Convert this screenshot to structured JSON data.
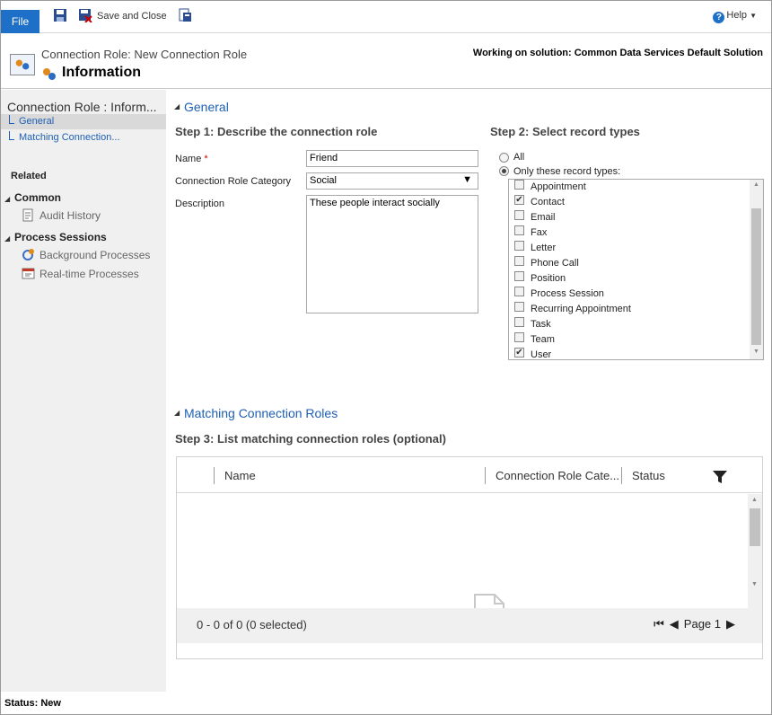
{
  "ribbon": {
    "file_label": "File",
    "save_close_label": "Save and Close",
    "help_label": "Help"
  },
  "header": {
    "subtitle": "Connection Role: New Connection Role",
    "title": "Information",
    "working_on": "Working on solution: Common Data Services Default Solution"
  },
  "nav": {
    "title": "Connection Role : Inform...",
    "links": [
      "General",
      "Matching Connection..."
    ],
    "related_label": "Related",
    "groups": [
      {
        "label": "Common",
        "items": [
          "Audit History"
        ]
      },
      {
        "label": "Process Sessions",
        "items": [
          "Background Processes",
          "Real-time Processes"
        ]
      }
    ]
  },
  "general": {
    "section_title": "General",
    "step1": "Step 1: Describe the connection role",
    "name_label": "Name",
    "name_required": "*",
    "name_value": "Friend",
    "category_label": "Connection Role Category",
    "category_value": "Social",
    "description_label": "Description",
    "description_value": "These people interact socially",
    "step2": "Step 2: Select record types",
    "radio_all": "All",
    "radio_only": "Only these record types:",
    "selected_radio": "only",
    "record_types": [
      {
        "label": "Appointment",
        "checked": false
      },
      {
        "label": "Contact",
        "checked": true
      },
      {
        "label": "Email",
        "checked": false
      },
      {
        "label": "Fax",
        "checked": false
      },
      {
        "label": "Letter",
        "checked": false
      },
      {
        "label": "Phone Call",
        "checked": false
      },
      {
        "label": "Position",
        "checked": false
      },
      {
        "label": "Process Session",
        "checked": false
      },
      {
        "label": "Recurring Appointment",
        "checked": false
      },
      {
        "label": "Task",
        "checked": false
      },
      {
        "label": "Team",
        "checked": false
      },
      {
        "label": "User",
        "checked": true
      }
    ]
  },
  "matching": {
    "section_title": "Matching Connection Roles",
    "step3": "Step 3: List matching connection roles (optional)",
    "columns": [
      "Name",
      "Connection Role Cate...",
      "Status"
    ],
    "count_text": "0 - 0 of 0 (0 selected)",
    "page_label": "Page 1"
  },
  "status_bar": {
    "text": "Status: New"
  },
  "colors": {
    "accent": "#1e6fc7",
    "link": "#1e5fb4",
    "nav_bg": "#f0f0f0"
  },
  "icons": [
    "save-icon",
    "save-close-icon",
    "assign-icon",
    "help-icon",
    "entity-icon",
    "audit-history-icon",
    "background-processes-icon",
    "realtime-processes-icon",
    "filter-icon",
    "empty-document-icon"
  ]
}
